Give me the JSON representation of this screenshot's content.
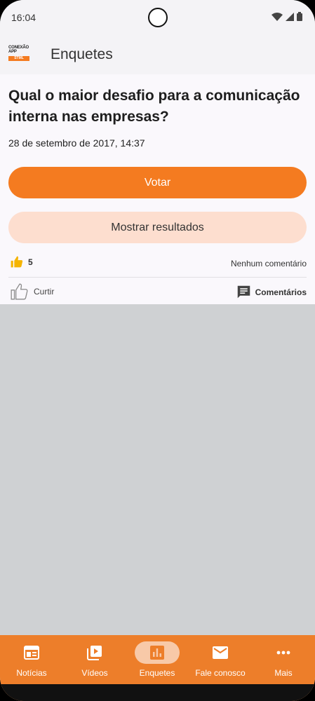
{
  "status": {
    "time": "16:04"
  },
  "appbar": {
    "logo_line1": "CONEXÃO",
    "logo_line2": "APP",
    "logo_badge": "STML",
    "title": "Enquetes"
  },
  "poll": {
    "question": "Qual o maior desafio para a comunicação interna nas empresas?",
    "date": "28 de setembro de 2017, 14:37",
    "vote_label": "Votar",
    "results_label": "Mostrar resultados",
    "likes_count": "5",
    "comments_summary": "Nenhum comentário",
    "like_label": "Curtir",
    "comments_label": "Comentários"
  },
  "bottom_nav": {
    "items": [
      {
        "label": "Notícias",
        "icon": "news-icon"
      },
      {
        "label": "Vídeos",
        "icon": "video-library-icon"
      },
      {
        "label": "Enquetes",
        "icon": "poll-icon",
        "active": true
      },
      {
        "label": "Fale conosco",
        "icon": "mail-icon"
      },
      {
        "label": "Mais",
        "icon": "more-icon"
      }
    ]
  },
  "colors": {
    "accent": "#f47b20",
    "nav_bg": "#ed7e2a",
    "results_bg": "#fddecf"
  }
}
